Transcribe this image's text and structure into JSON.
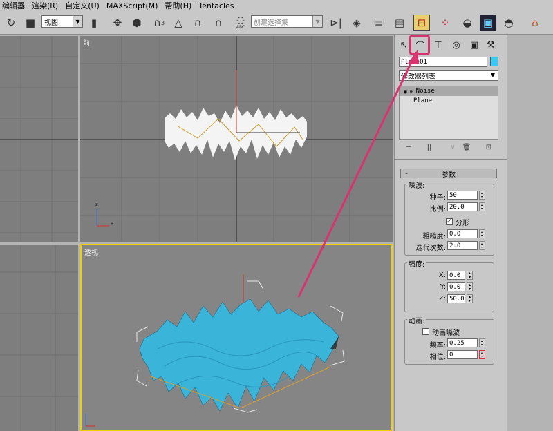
{
  "menu": {
    "items": [
      "编辑器",
      "渲染(R)",
      "自定义(U)",
      "MAXScript(M)",
      "帮助(H)",
      "Tentacles"
    ]
  },
  "toolbar": {
    "view_combo": "视图",
    "selection_set_placeholder": "创建选择集",
    "snap_label": "3",
    "abc_label": "ABC"
  },
  "viewports": {
    "front_label": "前",
    "persp_label": "透视",
    "axis_x": "x",
    "axis_z": "z"
  },
  "command_panel": {
    "object_name": "Plane01",
    "object_color": "#3cc8f0",
    "modifier_list": "修改器列表",
    "stack": [
      "Noise",
      "Plane"
    ],
    "rollout_title": "参数",
    "noise_group": "噪波:",
    "seed_label": "种子:",
    "seed_value": "50",
    "scale_label": "比例:",
    "scale_value": "20.0",
    "fractal_label": "分形",
    "fractal_checked": true,
    "roughness_label": "粗糙度:",
    "roughness_value": "0.0",
    "iterations_label": "迭代次数:",
    "iterations_value": "2.0",
    "strength_group": "强度:",
    "x_label": "X:",
    "x_value": "0.0",
    "y_label": "Y:",
    "y_value": "0.0",
    "z_label": "Z:",
    "z_value": "50.0",
    "anim_group": "动画:",
    "anim_noise_label": "动画噪波",
    "anim_noise_checked": false,
    "freq_label": "频率:",
    "freq_value": "0.25",
    "phase_label": "相位:",
    "phase_value": "0"
  },
  "colors": {
    "highlight": "#d8336f",
    "active_viewport": "#f0d000",
    "mesh": "#3ab4d8"
  }
}
